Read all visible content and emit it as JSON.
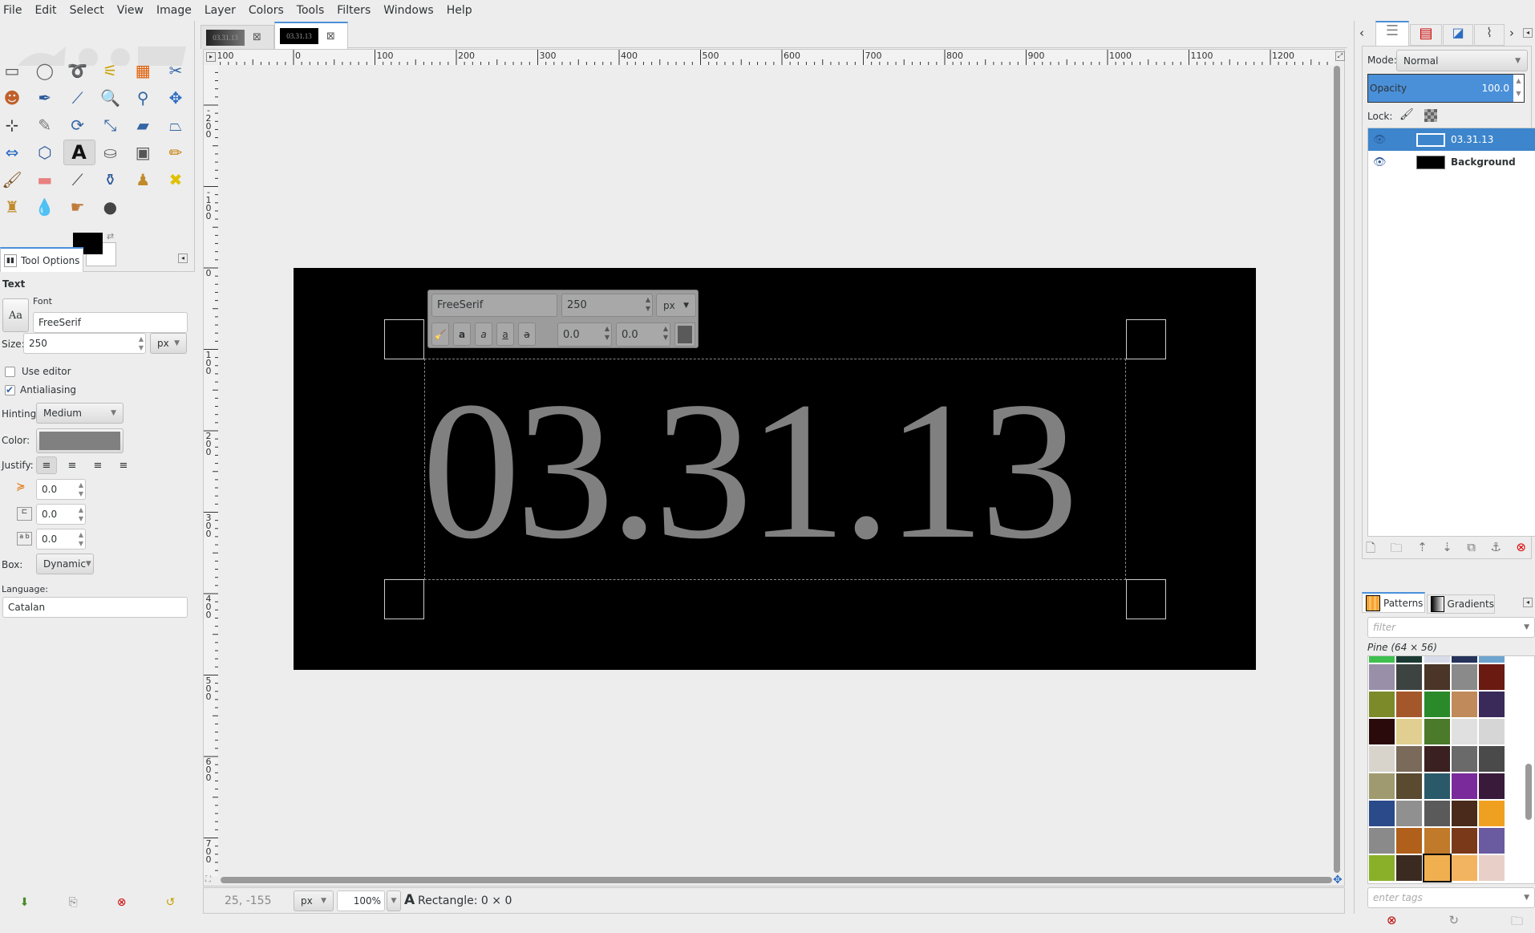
{
  "menu": [
    "File",
    "Edit",
    "Select",
    "View",
    "Image",
    "Layer",
    "Colors",
    "Tools",
    "Filters",
    "Windows",
    "Help"
  ],
  "tools": [
    {
      "name": "rect-select",
      "glyph": "▭",
      "color": "#555"
    },
    {
      "name": "ellipse-select",
      "glyph": "◯",
      "color": "#666"
    },
    {
      "name": "free-select",
      "glyph": "➰",
      "color": "#777"
    },
    {
      "name": "fuzzy-select",
      "glyph": "⚟",
      "color": "#c9a200"
    },
    {
      "name": "select-by-color",
      "glyph": "▦",
      "color": "#e05a00"
    },
    {
      "name": "scissors-select",
      "glyph": "✂",
      "color": "#3465a4"
    },
    {
      "name": "foreground-select",
      "glyph": "☻",
      "color": "#c0602a"
    },
    {
      "name": "paths",
      "glyph": "✒",
      "color": "#2c5a9a"
    },
    {
      "name": "color-picker",
      "glyph": "⟋",
      "color": "#2c5a9a"
    },
    {
      "name": "zoom",
      "glyph": "🔍",
      "color": "#6a8fcb"
    },
    {
      "name": "measure",
      "glyph": "⚲",
      "color": "#3465a4"
    },
    {
      "name": "move",
      "glyph": "✥",
      "color": "#2c6cc4"
    },
    {
      "name": "align",
      "glyph": "⊹",
      "color": "#333"
    },
    {
      "name": "crop",
      "glyph": "✎",
      "color": "#777"
    },
    {
      "name": "rotate",
      "glyph": "⟳",
      "color": "#3465a4"
    },
    {
      "name": "scale",
      "glyph": "⤡",
      "color": "#3465a4"
    },
    {
      "name": "shear",
      "glyph": "▰",
      "color": "#3465a4"
    },
    {
      "name": "perspective",
      "glyph": "⏢",
      "color": "#3465a4"
    },
    {
      "name": "flip",
      "glyph": "⇔",
      "color": "#2c6cc4"
    },
    {
      "name": "cage-transform",
      "glyph": "⬡",
      "color": "#2c5a9a"
    },
    {
      "name": "text",
      "glyph": "A",
      "color": "#111"
    },
    {
      "name": "bucket-fill",
      "glyph": "⛀",
      "color": "#666"
    },
    {
      "name": "blend",
      "glyph": "▣",
      "color": "#555"
    },
    {
      "name": "pencil",
      "glyph": "✏",
      "color": "#c47a00"
    },
    {
      "name": "paintbrush",
      "glyph": "🖌",
      "color": "#7a4a1a"
    },
    {
      "name": "eraser",
      "glyph": "▬",
      "color": "#e88080"
    },
    {
      "name": "airbrush",
      "glyph": "⟋",
      "color": "#444"
    },
    {
      "name": "ink",
      "glyph": "⚱",
      "color": "#2c5a9a"
    },
    {
      "name": "clone",
      "glyph": "♟",
      "color": "#c08a2a"
    },
    {
      "name": "heal",
      "glyph": "✖",
      "color": "#e0c000"
    },
    {
      "name": "perspective-clone",
      "glyph": "♜",
      "color": "#c08a2a"
    },
    {
      "name": "blur-sharpen",
      "glyph": "💧",
      "color": "#6a9ad4"
    },
    {
      "name": "smudge",
      "glyph": "☛",
      "color": "#c07a3a"
    },
    {
      "name": "dodge-burn",
      "glyph": "●",
      "color": "#444"
    }
  ],
  "colors": {
    "foreground": "#000000",
    "background": "#ffffff",
    "accent": "#4a90d9",
    "text_color": "#808080"
  },
  "tool_options": {
    "tab_label": "Tool Options",
    "section": "Text",
    "font_label": "Font",
    "font_value": "FreeSerif",
    "font_preview": "Aa",
    "size_label": "Size:",
    "size_value": "250",
    "size_unit": "px",
    "use_editor_label": "Use editor",
    "use_editor": false,
    "antialiasing_label": "Antialiasing",
    "antialiasing": true,
    "hinting_label": "Hinting:",
    "hinting_value": "Medium",
    "color_label": "Color:",
    "justify_label": "Justify:",
    "indent_value": "0.0",
    "line_spacing_value": "0.0",
    "letter_spacing_value": "0.0",
    "box_label": "Box:",
    "box_value": "Dynamic",
    "language_label": "Language:",
    "language_value": "Catalan"
  },
  "image_tabs": [
    {
      "label": "03.31.13",
      "active": false
    },
    {
      "label": "03.31.13",
      "active": true
    }
  ],
  "ruler": {
    "h_labels": [
      "-100",
      "0",
      "100",
      "200",
      "300",
      "400",
      "500",
      "600",
      "700",
      "800",
      "900",
      "1000",
      "1100",
      "1200"
    ],
    "v_labels": [
      "-200",
      "-100",
      "0",
      "100",
      "200",
      "300",
      "400",
      "500",
      "600",
      "700"
    ]
  },
  "canvas": {
    "text": "03.31.13"
  },
  "text_toolbar": {
    "font": "FreeSerif",
    "size": "250",
    "unit": "px",
    "baseline": "0.0",
    "kerning": "0.0"
  },
  "status": {
    "coords": "25, -155",
    "unit": "px",
    "zoom": "100%",
    "message": "Rectangle: 0 × 0"
  },
  "layers": {
    "mode_label": "Mode:",
    "mode_value": "Normal",
    "opacity_label": "Opacity",
    "opacity_value": "100.0",
    "lock_label": "Lock:",
    "items": [
      {
        "name": "03.31.13",
        "selected": true,
        "visible": true
      },
      {
        "name": "Background",
        "selected": false,
        "visible": true
      }
    ]
  },
  "patterns": {
    "tab_patterns": "Patterns",
    "tab_gradients": "Gradients",
    "filter_placeholder": "filter",
    "selected_label": "Pine (64 × 56)",
    "tags_placeholder": "enter tags",
    "swatches": [
      "#3fbf4f",
      "#1b3a34",
      "#d8dcea",
      "#26335a",
      "#6fa4cf",
      "#9a8fa8",
      "#3c4340",
      "#4a3528",
      "#8a8a8a",
      "#6a1a10",
      "#7c8a2a",
      "#a4572a",
      "#2a8a2a",
      "#c08a5a",
      "#3a2a5a",
      "#2a0a0a",
      "#e0cf90",
      "#4a7a2a",
      "#e0e0e0",
      "#d6d6d6",
      "#d8d4cc",
      "#7a6a5a",
      "#3a2020",
      "#6a6a6a",
      "#4a4a4a",
      "#a09a70",
      "#5a4a30",
      "#2a5a6a",
      "#7a2a9a",
      "#3a1a3a",
      "#2a4a8a",
      "#909090",
      "#5a5a5a",
      "#4a2a1a",
      "#f0a020",
      "#8a8a8a",
      "#b0601a",
      "#c07a2a",
      "#7a3a1a",
      "#6a5aa0",
      "#8ab02a",
      "#3a2a20",
      "#f0b050",
      "#f2b460",
      "#e8d0c8"
    ],
    "selected_index": 42
  }
}
